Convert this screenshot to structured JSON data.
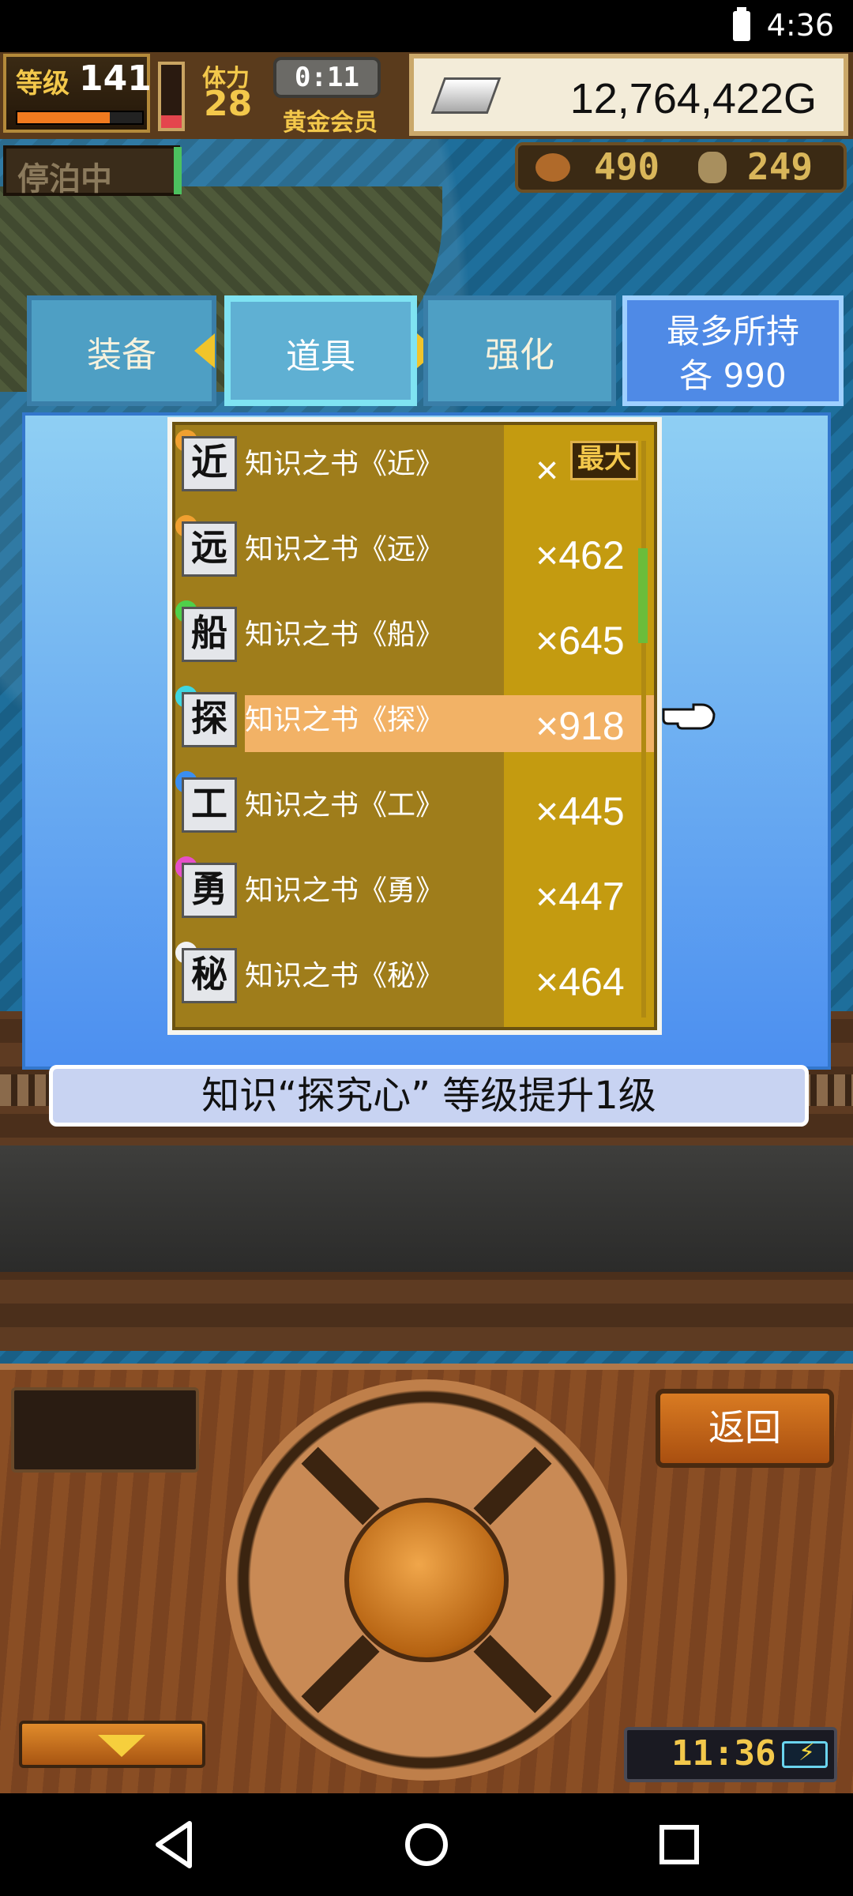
{
  "status_bar": {
    "time": "4:36"
  },
  "hud": {
    "level_label": "等级",
    "level_value": "141",
    "exp_fraction": 0.74,
    "stamina_label": "体力",
    "stamina_value": "28",
    "stamina_fraction": 0.2,
    "timer": "0:11",
    "member_label": "黄金会员",
    "money": "12,764,422G",
    "docked_label": "停泊中",
    "food": "490",
    "wood": "249"
  },
  "tabs": [
    {
      "label": "装备"
    },
    {
      "label": "道具"
    },
    {
      "label": "强化"
    }
  ],
  "max_hold": {
    "line1": "最多所持",
    "line2": "各 990"
  },
  "items": [
    {
      "icon_char": "近",
      "dot_color": "#f0a030",
      "name": "知识之书《近》",
      "qty_prefix": "×",
      "qty": "",
      "max_badge": "最大"
    },
    {
      "icon_char": "远",
      "dot_color": "#f0a030",
      "name": "知识之书《远》",
      "qty": "×462"
    },
    {
      "icon_char": "船",
      "dot_color": "#4fd04a",
      "name": "知识之书《船》",
      "qty": "×645"
    },
    {
      "icon_char": "探",
      "dot_color": "#3fd6e0",
      "name": "知识之书《探》",
      "qty": "×918"
    },
    {
      "icon_char": "工",
      "dot_color": "#3a8ef0",
      "name": "知识之书《工》",
      "qty": "×445"
    },
    {
      "icon_char": "勇",
      "dot_color": "#e64fc8",
      "name": "知识之书《勇》",
      "qty": "×447"
    },
    {
      "icon_char": "秘",
      "dot_color": "#f2f2f2",
      "name": "知识之书《秘》",
      "qty": "×464"
    }
  ],
  "message": "知识“探究心” 等级提升1级",
  "panel": {
    "back_label": "返回",
    "clock": "11:36"
  }
}
